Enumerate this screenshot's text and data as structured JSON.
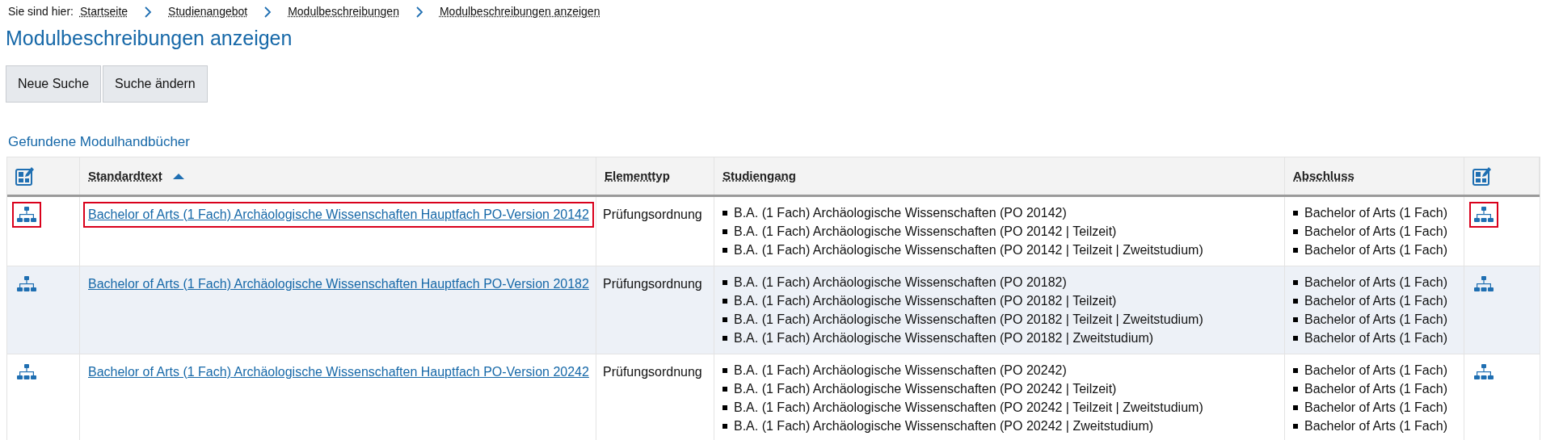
{
  "breadcrumb": {
    "label": "Sie sind hier:",
    "items": [
      "Startseite",
      "Studienangebot",
      "Modulbeschreibungen",
      "Modulbeschreibungen anzeigen"
    ]
  },
  "title": "Modulbeschreibungen anzeigen",
  "buttons": [
    "Neue Suche",
    "Suche ändern"
  ],
  "table": {
    "caption": "Gefundene Modulhandbücher",
    "columns": [
      {
        "kind": "icon"
      },
      {
        "kind": "text",
        "label": "Standardtext",
        "sorted": true
      },
      {
        "kind": "text",
        "label": "Elementtyp",
        "sorted": false
      },
      {
        "kind": "text",
        "label": "Studiengang",
        "sorted": false
      },
      {
        "kind": "text",
        "label": "Abschluss",
        "sorted": false
      },
      {
        "kind": "icon"
      }
    ],
    "rows": [
      {
        "highlighted": true,
        "standardtext": "Bachelor of Arts (1 Fach) Archäologische Wissenschaften Hauptfach PO-Version 20142",
        "elementtyp": "Prüfungsordnung",
        "studiengang": [
          "B.A. (1 Fach) Archäologische Wissenschaften (PO 20142)",
          "B.A. (1 Fach) Archäologische Wissenschaften (PO 20142 | Teilzeit)",
          "B.A. (1 Fach) Archäologische Wissenschaften (PO 20142 | Teilzeit | Zweitstudium)"
        ],
        "abschluss": [
          "Bachelor of Arts (1 Fach)",
          "Bachelor of Arts (1 Fach)",
          "Bachelor of Arts (1 Fach)"
        ]
      },
      {
        "highlighted": false,
        "standardtext": "Bachelor of Arts (1 Fach) Archäologische Wissenschaften Hauptfach PO-Version 20182",
        "elementtyp": "Prüfungsordnung",
        "studiengang": [
          "B.A. (1 Fach) Archäologische Wissenschaften (PO 20182)",
          "B.A. (1 Fach) Archäologische Wissenschaften (PO 20182 | Teilzeit)",
          "B.A. (1 Fach) Archäologische Wissenschaften (PO 20182 | Teilzeit | Zweitstudium)",
          "B.A. (1 Fach) Archäologische Wissenschaften (PO 20182 | Zweitstudium)"
        ],
        "abschluss": [
          "Bachelor of Arts (1 Fach)",
          "Bachelor of Arts (1 Fach)",
          "Bachelor of Arts (1 Fach)",
          "Bachelor of Arts (1 Fach)"
        ]
      },
      {
        "highlighted": false,
        "standardtext": "Bachelor of Arts (1 Fach) Archäologische Wissenschaften Hauptfach PO-Version 20242",
        "elementtyp": "Prüfungsordnung",
        "studiengang": [
          "B.A. (1 Fach) Archäologische Wissenschaften (PO 20242)",
          "B.A. (1 Fach) Archäologische Wissenschaften (PO 20242 | Teilzeit)",
          "B.A. (1 Fach) Archäologische Wissenschaften (PO 20242 | Teilzeit | Zweitstudium)",
          "B.A. (1 Fach) Archäologische Wissenschaften (PO 20242 | Zweitstudium)"
        ],
        "abschluss": [
          "Bachelor of Arts (1 Fach)",
          "Bachelor of Arts (1 Fach)",
          "Bachelor of Arts (1 Fach)",
          "Bachelor of Arts (1 Fach)"
        ]
      }
    ]
  }
}
